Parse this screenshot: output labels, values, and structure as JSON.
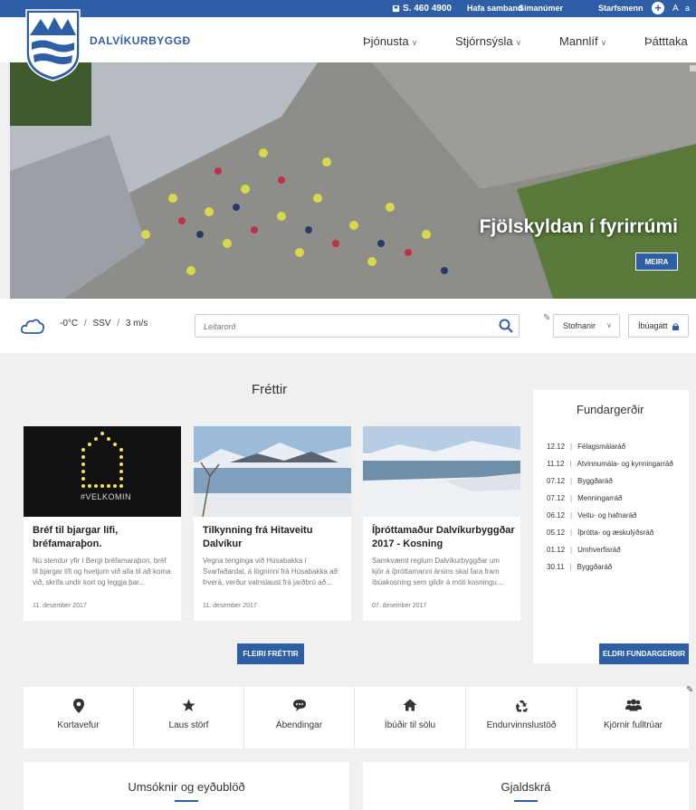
{
  "topbar": {
    "phone": "S. 460 4900",
    "contact": "Hafa samband",
    "phonebook": "Símanúmer",
    "staff": "Starfsmenn",
    "font_a_small": "A",
    "font_a_large": "a"
  },
  "brand": {
    "name": "DALVÍKURBYGGÐ"
  },
  "nav": [
    {
      "label": "Þjónusta"
    },
    {
      "label": "Stjórnsýsla"
    },
    {
      "label": "Mannlíf"
    },
    {
      "label": "Þátttaka"
    }
  ],
  "hero": {
    "title": "Fjölskyldan í fyrirrúmi",
    "button": "MEIRA"
  },
  "weather": {
    "temp": "-0°C",
    "wind_dir": "SSV",
    "wind_speed": "3 m/s"
  },
  "search": {
    "placeholder": "Leitarorð"
  },
  "tools": {
    "institutions": "Stofnanir",
    "residents": "Íbúagátt"
  },
  "news": {
    "title": "Fréttir",
    "more_button": "FLEIRI FRÉTTIR",
    "items": [
      {
        "image_label": "#VELKOMIN",
        "title": "Bréf til bjargar lífi, bréfamaraþon.",
        "text": "Nú stendur yfir í Bergi bréfamaraþon, bréf til bjargar lífi og hvetjum við alla til að koma við, skrifa undir kort og leggja þar...",
        "date": "11. desember 2017"
      },
      {
        "title": "Tilkynning frá Hitaveitu Dalvíkur",
        "text": "Vegna tenginga við Húsabakka í Svarfaðardal, á lögninni frá Húsabakka að Þverá, verður vatnslaust frá jarðbrú að...",
        "date": "11. desember 2017"
      },
      {
        "title": "Íþróttamaður Dalvíkurbyggðar 2017 - Kosning",
        "text": "Samkvæmt reglum Dalvíkurbyggðar um kjör á íþróttamanni ársins skal fara fram íbúakosning sem gildir á móti kosningu...",
        "date": "07. desember 2017"
      }
    ]
  },
  "meetings": {
    "title": "Fundargerðir",
    "button": "ELDRI FUNDARGERÐIR",
    "items": [
      {
        "date": "12.12",
        "name": "Félagsmálaráð"
      },
      {
        "date": "11.12",
        "name": "Atvinnumála- og kynningarráð"
      },
      {
        "date": "07.12",
        "name": "Byggðaráð"
      },
      {
        "date": "07.12",
        "name": "Menningarráð"
      },
      {
        "date": "06.12",
        "name": "Veitu- og hafnaráð"
      },
      {
        "date": "05.12",
        "name": "Íþrótta- og æskulýðsráð"
      },
      {
        "date": "01.12",
        "name": "Umhverfisráð"
      },
      {
        "date": "30.11",
        "name": "Byggðaráð"
      }
    ]
  },
  "quick_links": [
    {
      "label": "Kortavefur",
      "icon": "map-marker-icon"
    },
    {
      "label": "Laus störf",
      "icon": "star-icon"
    },
    {
      "label": "Ábendingar",
      "icon": "comment-icon"
    },
    {
      "label": "Íbúðir til sölu",
      "icon": "home-icon"
    },
    {
      "label": "Endurvinnslustöð",
      "icon": "recycle-icon"
    },
    {
      "label": "Kjörnir fulltrúar",
      "icon": "users-icon"
    }
  ],
  "bottom": {
    "forms": "Umsóknir og eyðublöð",
    "fees": "Gjaldskrá"
  },
  "colors": {
    "primary": "#2e5ea6",
    "background": "#f0f0f0"
  }
}
